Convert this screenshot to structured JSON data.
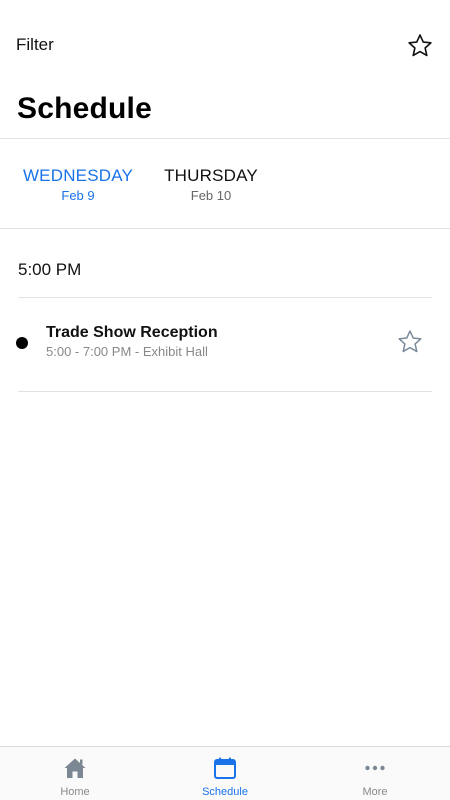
{
  "header": {
    "filter_label": "Filter",
    "favorites_icon": "star-outline-icon",
    "title": "Schedule"
  },
  "days": [
    {
      "day": "WEDNESDAY",
      "date": "Feb 9",
      "active": true
    },
    {
      "day": "THURSDAY",
      "date": "Feb 10",
      "active": false
    }
  ],
  "time_slot": "5:00 PM",
  "sessions": [
    {
      "title": "Trade Show Reception",
      "meta": "5:00 - 7:00 PM - Exhibit Hall",
      "favorite": false
    }
  ],
  "tabbar": {
    "items": [
      {
        "label": "Home",
        "icon": "home-icon",
        "active": false
      },
      {
        "label": "Schedule",
        "icon": "calendar-icon",
        "active": true
      },
      {
        "label": "More",
        "icon": "more-dots-icon",
        "active": false
      }
    ]
  },
  "colors": {
    "accent": "#1a73e8",
    "text": "#111111",
    "muted": "#888888",
    "divider": "#e2e2e2"
  }
}
